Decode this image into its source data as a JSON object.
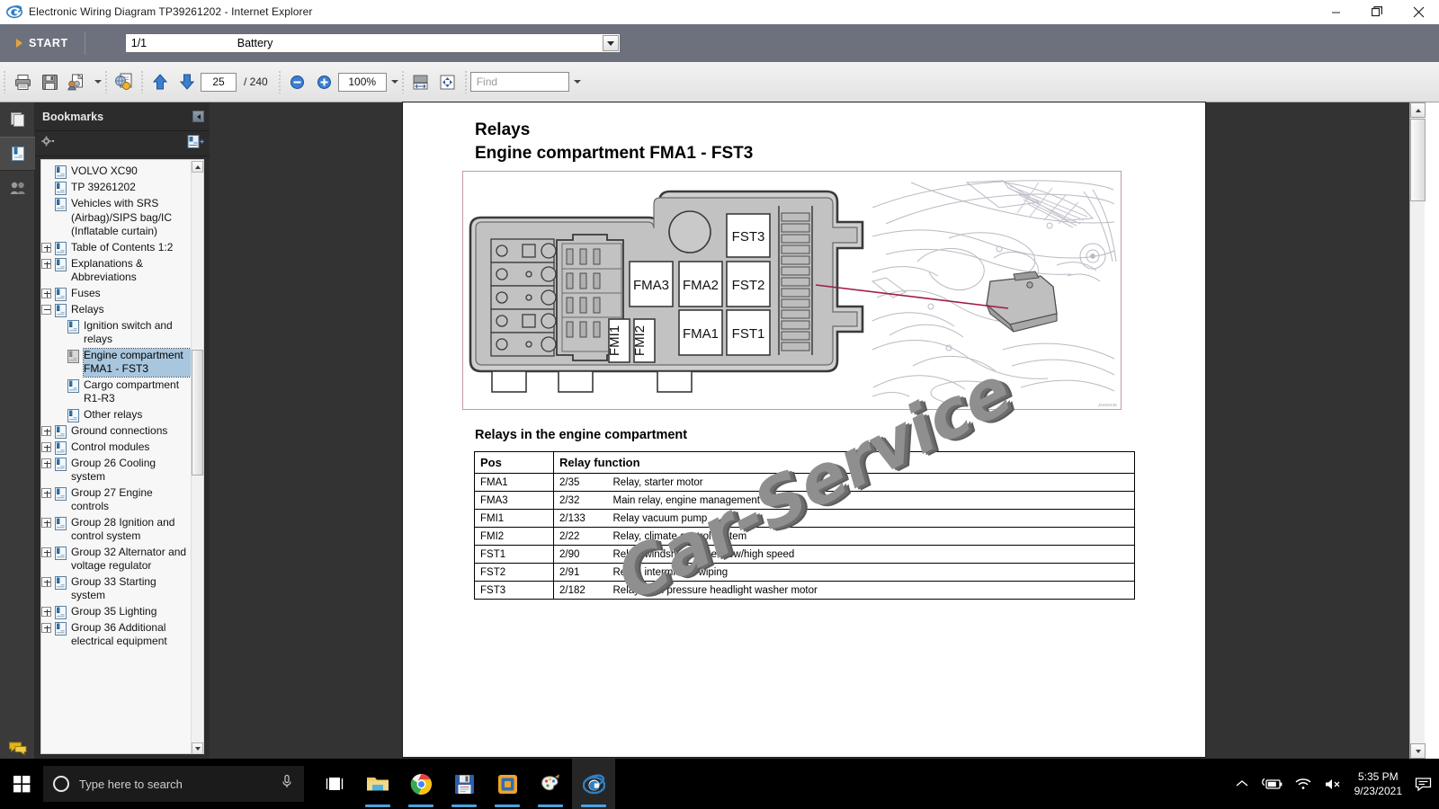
{
  "window": {
    "title": "Electronic Wiring Diagram TP39261202 - Internet Explorer",
    "app_icon": "internet-explorer-icon",
    "minimize": "—",
    "maximize": "❐",
    "close": "✕"
  },
  "startbar": {
    "start_label": "START",
    "page_select": {
      "number": "1/1",
      "label": "Battery"
    }
  },
  "toolbar": {
    "print": "print-icon",
    "save": "save-icon",
    "email": "email-icon",
    "find_globe": "search-document-icon",
    "prev_page": "arrow-up-icon",
    "next_page": "arrow-down-icon",
    "page_current": "25",
    "page_total": "/ 240",
    "zoom_out": "zoom-out-icon",
    "zoom_in": "zoom-in-icon",
    "zoom_level": "100%",
    "fit_width": "fit-width-icon",
    "fit_page": "fit-page-icon",
    "find_placeholder": "Find"
  },
  "rail": {
    "items": [
      {
        "name": "pages-thumbnail-icon",
        "active": false
      },
      {
        "name": "bookmarks-icon",
        "active": true
      },
      {
        "name": "signatures-icon",
        "active": false
      },
      {
        "name": "comments-icon",
        "active": false
      },
      {
        "name": "attachments-icon",
        "active": false
      }
    ]
  },
  "bookmarks": {
    "header": "Bookmarks",
    "collapse_icon": "collapse-panel-icon",
    "options_icon": "gear-dropdown-icon",
    "expand_all_icon": "expand-bookmark-icon",
    "tree": [
      {
        "label": "VOLVO XC90",
        "indent": 0,
        "toggle": "none",
        "selected": false
      },
      {
        "label": "TP 39261202",
        "indent": 0,
        "toggle": "none",
        "selected": false
      },
      {
        "label": "Vehicles with SRS (Airbag)/SIPS bag/IC (Inflatable curtain)",
        "indent": 0,
        "toggle": "none",
        "selected": false
      },
      {
        "label": "Table of Contents 1:2",
        "indent": 0,
        "toggle": "plus",
        "selected": false
      },
      {
        "label": "Explanations & Abbreviations",
        "indent": 0,
        "toggle": "plus",
        "selected": false
      },
      {
        "label": "Fuses",
        "indent": 0,
        "toggle": "plus",
        "selected": false
      },
      {
        "label": "Relays",
        "indent": 0,
        "toggle": "minus",
        "selected": false
      },
      {
        "label": "Ignition switch and relays",
        "indent": 1,
        "toggle": "none",
        "selected": false
      },
      {
        "label": "Engine compartment FMA1 - FST3",
        "indent": 1,
        "toggle": "none",
        "selected": true
      },
      {
        "label": "Cargo compartment R1-R3",
        "indent": 1,
        "toggle": "none",
        "selected": false
      },
      {
        "label": "Other relays",
        "indent": 1,
        "toggle": "none",
        "selected": false
      },
      {
        "label": "Ground connections",
        "indent": 0,
        "toggle": "plus",
        "selected": false
      },
      {
        "label": "Control modules",
        "indent": 0,
        "toggle": "plus",
        "selected": false
      },
      {
        "label": "Group 26 Cooling system",
        "indent": 0,
        "toggle": "plus",
        "selected": false
      },
      {
        "label": "Group 27 Engine controls",
        "indent": 0,
        "toggle": "plus",
        "selected": false
      },
      {
        "label": "Group 28 Ignition and control system",
        "indent": 0,
        "toggle": "plus",
        "selected": false
      },
      {
        "label": "Group 32 Alternator and voltage regulator",
        "indent": 0,
        "toggle": "plus",
        "selected": false
      },
      {
        "label": "Group 33 Starting system",
        "indent": 0,
        "toggle": "plus",
        "selected": false
      },
      {
        "label": "Group 35 Lighting",
        "indent": 0,
        "toggle": "plus",
        "selected": false
      },
      {
        "label": "Group 36 Additional electrical equipment",
        "indent": 0,
        "toggle": "plus",
        "selected": false
      }
    ]
  },
  "document": {
    "title_line1": "Relays",
    "title_line2": "Engine compartment FMA1 - FST3",
    "figure": {
      "fuse_box_labels": [
        "FST3",
        "FMA3",
        "FMA2",
        "FST2",
        "FMA1",
        "FST1",
        "FMI1",
        "FMI2"
      ],
      "figure_id": "J2463435"
    },
    "section_heading": "Relays in the engine compartment",
    "table": {
      "headers": [
        "Pos",
        "Relay function"
      ],
      "rows": [
        {
          "pos": "FMA1",
          "num": "2/35",
          "fn": "Relay, starter motor"
        },
        {
          "pos": "FMA3",
          "num": "2/32",
          "fn": "Main relay, engine management system"
        },
        {
          "pos": "FMI1",
          "num": "2/133",
          "fn": "Relay vacuum pump"
        },
        {
          "pos": "FMI2",
          "num": "2/22",
          "fn": "Relay, climate control system"
        },
        {
          "pos": "FST1",
          "num": "2/90",
          "fn": "Relay, windshield wiper, low/high speed"
        },
        {
          "pos": "FST2",
          "num": "2/91",
          "fn": "Relay, intermittent wiping"
        },
        {
          "pos": "FST3",
          "num": "2/182",
          "fn": "Relay, high pressure headlight washer motor"
        }
      ]
    },
    "watermark": "Car-Service"
  },
  "taskbar": {
    "start_icon": "windows-start-icon",
    "search_placeholder": "Type here to search",
    "cortana_icon": "cortana-circle-icon",
    "mic_icon": "microphone-icon",
    "apps": [
      {
        "name": "task-view-icon",
        "open": false
      },
      {
        "name": "file-explorer-icon",
        "open": true
      },
      {
        "name": "google-chrome-icon",
        "open": true
      },
      {
        "name": "save-disk-app-icon",
        "open": true
      },
      {
        "name": "vmware-icon",
        "open": true
      },
      {
        "name": "paint-icon",
        "open": true
      },
      {
        "name": "internet-explorer-icon",
        "open": true,
        "active": true
      }
    ],
    "tray": {
      "show_hidden_icon": "chevron-up-icon",
      "battery_icon": "battery-charging-icon",
      "network_icon": "wifi-icon",
      "volume_icon": "volume-muted-icon",
      "time": "5:35 PM",
      "date": "9/23/2021",
      "action_center_icon": "notifications-icon"
    }
  },
  "colors": {
    "startbar_bg": "#6d717e",
    "panel_bg": "#2c2c2c",
    "doc_bg": "#333333",
    "selection": "#a8c6de",
    "figure_border": "#c49aa6",
    "accent_orange": "#e8a33d"
  }
}
